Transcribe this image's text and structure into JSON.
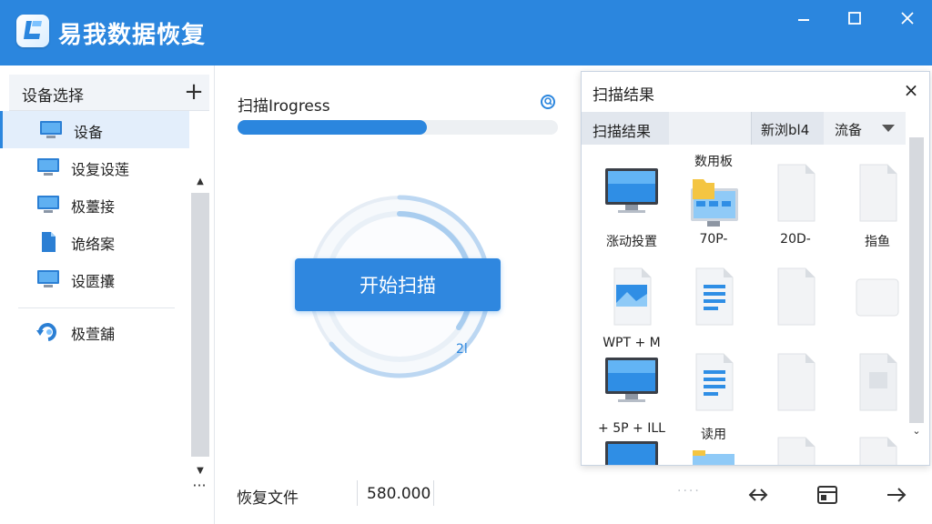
{
  "app": {
    "title": "易我数据恢复",
    "colors": {
      "accent": "#2b86de",
      "title_bar": "#2b86de"
    }
  },
  "window_controls": {
    "minimize_icon": "minimize-icon",
    "maximize_icon": "maximize-icon",
    "close_icon": "close-icon"
  },
  "sidebar": {
    "header_label": "设备选择",
    "add_label": "+",
    "items": [
      {
        "label": "设备",
        "icon": "monitor-icon",
        "selected": true
      },
      {
        "label": "设复设莲",
        "icon": "monitor-icon",
        "selected": false
      },
      {
        "label": "极薹接",
        "icon": "monitor-icon",
        "selected": false
      },
      {
        "label": "诡络案",
        "icon": "file-icon",
        "selected": false
      },
      {
        "label": "设匮攮",
        "icon": "monitor-icon",
        "selected": false
      }
    ],
    "extra_item": {
      "label": "极萱舖",
      "icon": "recovery-icon"
    },
    "more_label": "···"
  },
  "main": {
    "progress_label": "扫描Irogress",
    "progress_value": 0.59,
    "start_button_label": "开始扫描",
    "ring_text": "2l"
  },
  "bottom": {
    "label": "恢复文件",
    "value": "580.000",
    "dots": "····"
  },
  "results": {
    "title": "扫描结果",
    "close_label": "×",
    "tab_label": "扫描结果",
    "filter_label": "新浏bl4",
    "sort_label": "流备",
    "items": [
      {
        "type": "monitor",
        "caption_top": "",
        "caption": "涨动投置"
      },
      {
        "type": "monitor-folder",
        "caption_top": "数用板",
        "caption": "70P-"
      },
      {
        "type": "blank",
        "caption_top": "",
        "caption": "20D-"
      },
      {
        "type": "blank",
        "caption_top": "",
        "caption": "指鱼"
      },
      {
        "type": "image-file",
        "caption_top": "",
        "caption": "WPT + M"
      },
      {
        "type": "doc-file",
        "caption_top": "",
        "caption": ""
      },
      {
        "type": "blank",
        "caption_top": "",
        "caption": ""
      },
      {
        "type": "blank-flat",
        "caption_top": "",
        "caption": ""
      },
      {
        "type": "monitor",
        "caption_top": "",
        "caption": "+ 5P + ILL"
      },
      {
        "type": "doc-file",
        "caption_top": "",
        "caption": ""
      },
      {
        "type": "blank",
        "caption_top": "",
        "caption": ""
      },
      {
        "type": "blank-gray",
        "caption_top": "",
        "caption": ""
      },
      {
        "type": "monitor-partial",
        "caption_top": "",
        "caption": ""
      },
      {
        "type": "folder-partial",
        "caption_top": "读用",
        "caption": ""
      },
      {
        "type": "blank",
        "caption_top": "",
        "caption": ""
      },
      {
        "type": "blank",
        "caption_top": "",
        "caption": ""
      }
    ]
  }
}
